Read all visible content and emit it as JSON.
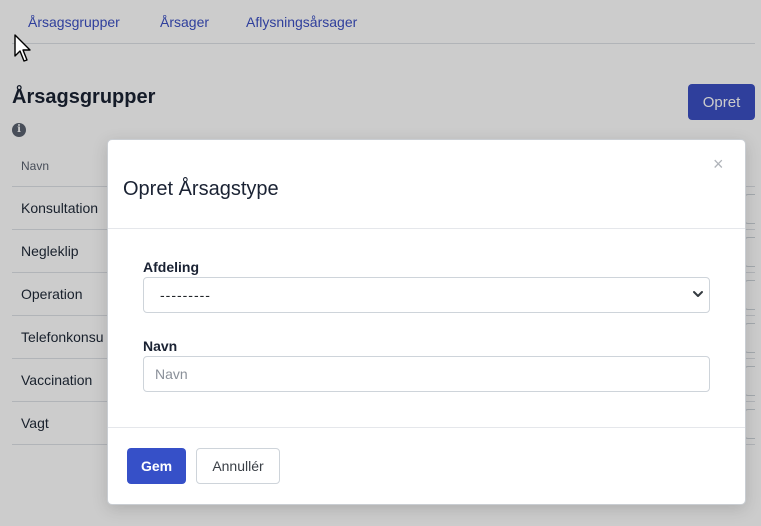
{
  "nav": {
    "tabs": [
      {
        "label": "Årsagsgrupper"
      },
      {
        "label": "Årsager"
      },
      {
        "label": "Aflysningsårsager"
      }
    ]
  },
  "page": {
    "title": "Årsagsgrupper",
    "info_icon": "info-circle-icon",
    "create_label": "Opret"
  },
  "table": {
    "columns": [
      "Navn"
    ],
    "rows": [
      {
        "name": "Konsultation"
      },
      {
        "name": "Negleklip"
      },
      {
        "name": "Operation"
      },
      {
        "name": "Telefonkonsu"
      },
      {
        "name": "Vaccination"
      },
      {
        "name": "Vagt"
      }
    ]
  },
  "modal": {
    "title": "Opret Årsagstype",
    "close_label": "×",
    "fields": {
      "department": {
        "label": "Afdeling",
        "value": "---------"
      },
      "name": {
        "label": "Navn",
        "placeholder": "Navn",
        "value": ""
      }
    },
    "save_label": "Gem",
    "cancel_label": "Annullér"
  },
  "colors": {
    "primary": "#3b4fc4",
    "overlay": "rgba(0,0,0,0.2)"
  }
}
